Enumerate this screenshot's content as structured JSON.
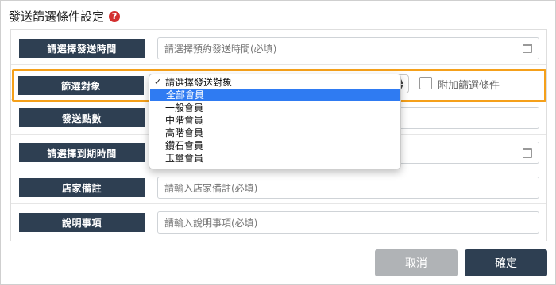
{
  "dialog": {
    "title": "發送篩選條件設定",
    "help_icon": "?"
  },
  "rows": [
    {
      "label": "請選擇發送時間",
      "placeholder": "請選擇預約發送時間(必填)",
      "icon": "calendar-icon"
    },
    {
      "label": "篩選對象",
      "select_value": "請選擇發送對象",
      "checkbox_label": "附加篩選條件",
      "checkbox_checked": false
    },
    {
      "label": "發送點數",
      "placeholder": ""
    },
    {
      "label": "請選擇到期時間",
      "placeholder": "",
      "icon": "calendar-icon"
    },
    {
      "label": "店家備註",
      "placeholder": "請輸入店家備註(必填)"
    },
    {
      "label": "說明事項",
      "placeholder": "請輸入說明事項(必填)"
    }
  ],
  "dropdown": {
    "options": [
      "請選擇發送對象",
      "全部會員",
      "一般會員",
      "中階會員",
      "高階會員",
      "鑽石會員",
      "玉璽會員"
    ],
    "checked_index": 0,
    "highlighted_index": 1
  },
  "footer": {
    "cancel_label": "取消",
    "confirm_label": "確定"
  },
  "colors": {
    "label_bg": "#2e3f52",
    "highlight_border": "#f5a01a",
    "selected_option": "#2f7bf2",
    "help_icon": "#d32f2f",
    "cancel_bg": "#b0b3b6"
  }
}
